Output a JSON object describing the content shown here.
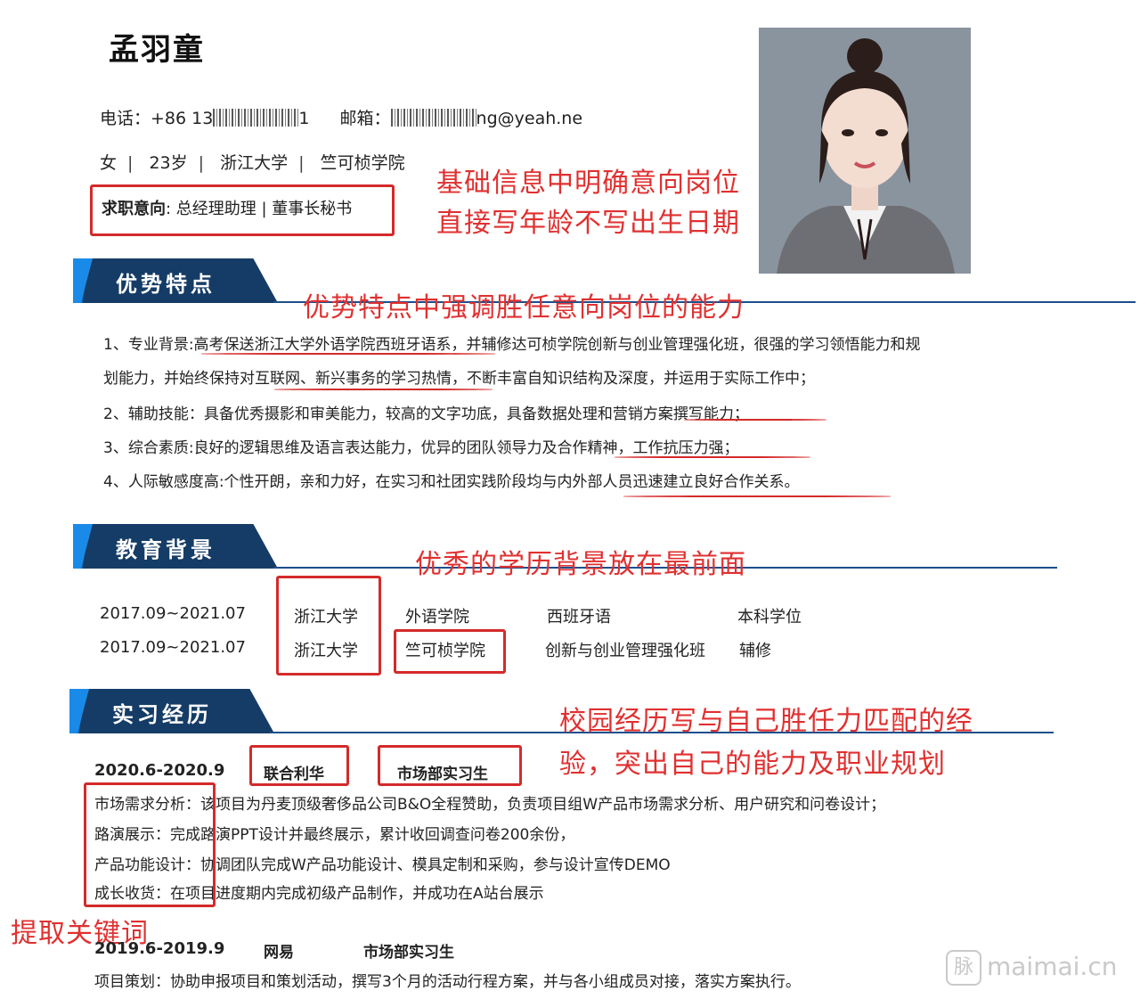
{
  "header": {
    "name": "孟羽童",
    "phone_label": "电话：",
    "phone_prefix": "+86 13",
    "phone_suffix": "1",
    "email_label": "邮箱：",
    "email_suffix": "ng@yeah.ne",
    "gender": "女",
    "age": "23岁",
    "university": "浙江大学",
    "college": "竺可桢学院",
    "intent_label": "求职意向",
    "intent_value": ": 总经理助理 | 董事长秘书"
  },
  "notes": {
    "basic_1": "基础信息中明确意向岗位",
    "basic_2": "直接写年龄不写出生日期",
    "strength": "优势特点中强调胜任意向岗位的能力",
    "education": "优秀的学历背景放在最前面",
    "intern_1": "校园经历写与自己胜任力匹配的经",
    "intern_2": "验，突出自己的能力及职业规划",
    "keywords": "提取关键词"
  },
  "sections": {
    "strengths": "优势特点",
    "education": "教育背景",
    "internship": "实习经历"
  },
  "strengths": [
    "1、专业背景:高考保送浙江大学外语学院西班牙语系，并辅修达可桢学院创新与创业管理强化班，很强的学习领悟能力和规",
    "划能力，并始终保持对互联网、新兴事务的学习热情，不断丰富自知识结构及深度，并运用于实际工作中；",
    "2、辅助技能：具备优秀摄影和审美能力，较高的文字功底，具备数据处理和营销方案撰写能力；",
    "3、综合素质:良好的逻辑思维及语言表达能力，优异的团队领导力及合作精神，工作抗压力强；",
    "4、人际敏感度高:个性开朗，亲和力好，在实习和社团实践阶段均与内外部人员迅速建立良好合作关系。"
  ],
  "education": [
    {
      "period": "2017.09~2021.07",
      "school": "浙江大学",
      "college": "外语学院",
      "major": "西班牙语",
      "degree": "本科学位"
    },
    {
      "period": "2017.09~2021.07",
      "school": "浙江大学",
      "college": "竺可桢学院",
      "major": "创新与创业管理强化班",
      "degree": "辅修"
    }
  ],
  "internships": [
    {
      "period": "2020.6-2020.9",
      "company": "联合利华",
      "role": "市场部实习生",
      "items": [
        {
          "key": "市场需求分析：",
          "text": "该项目为丹麦顶级奢侈品公司B&O全程赞助，负责项目组W产品市场需求分析、用户研究和问卷设计；"
        },
        {
          "key": "路演展示：",
          "text": "完成路演PPT设计并最终展示，累计收回调查问卷200余份，"
        },
        {
          "key": "产品功能设计：",
          "text": "协调团队完成W产品功能设计、模具定制和采购，参与设计宣传DEMO"
        },
        {
          "key": "成长收货：",
          "text": "在项目进度期内完成初级产品制作，并成功在A站台展示"
        }
      ]
    },
    {
      "period": "2019.6-2019.9",
      "company": "网易",
      "role": "市场部实习生",
      "items": [
        {
          "key": "项目策划：",
          "text": "协助申报项目和策划活动，撰写3个月的活动行程方案，并与各小组成员对接，落实方案执行。"
        }
      ]
    }
  ],
  "watermark": {
    "icon": "脉",
    "text": "maimai.cn"
  }
}
